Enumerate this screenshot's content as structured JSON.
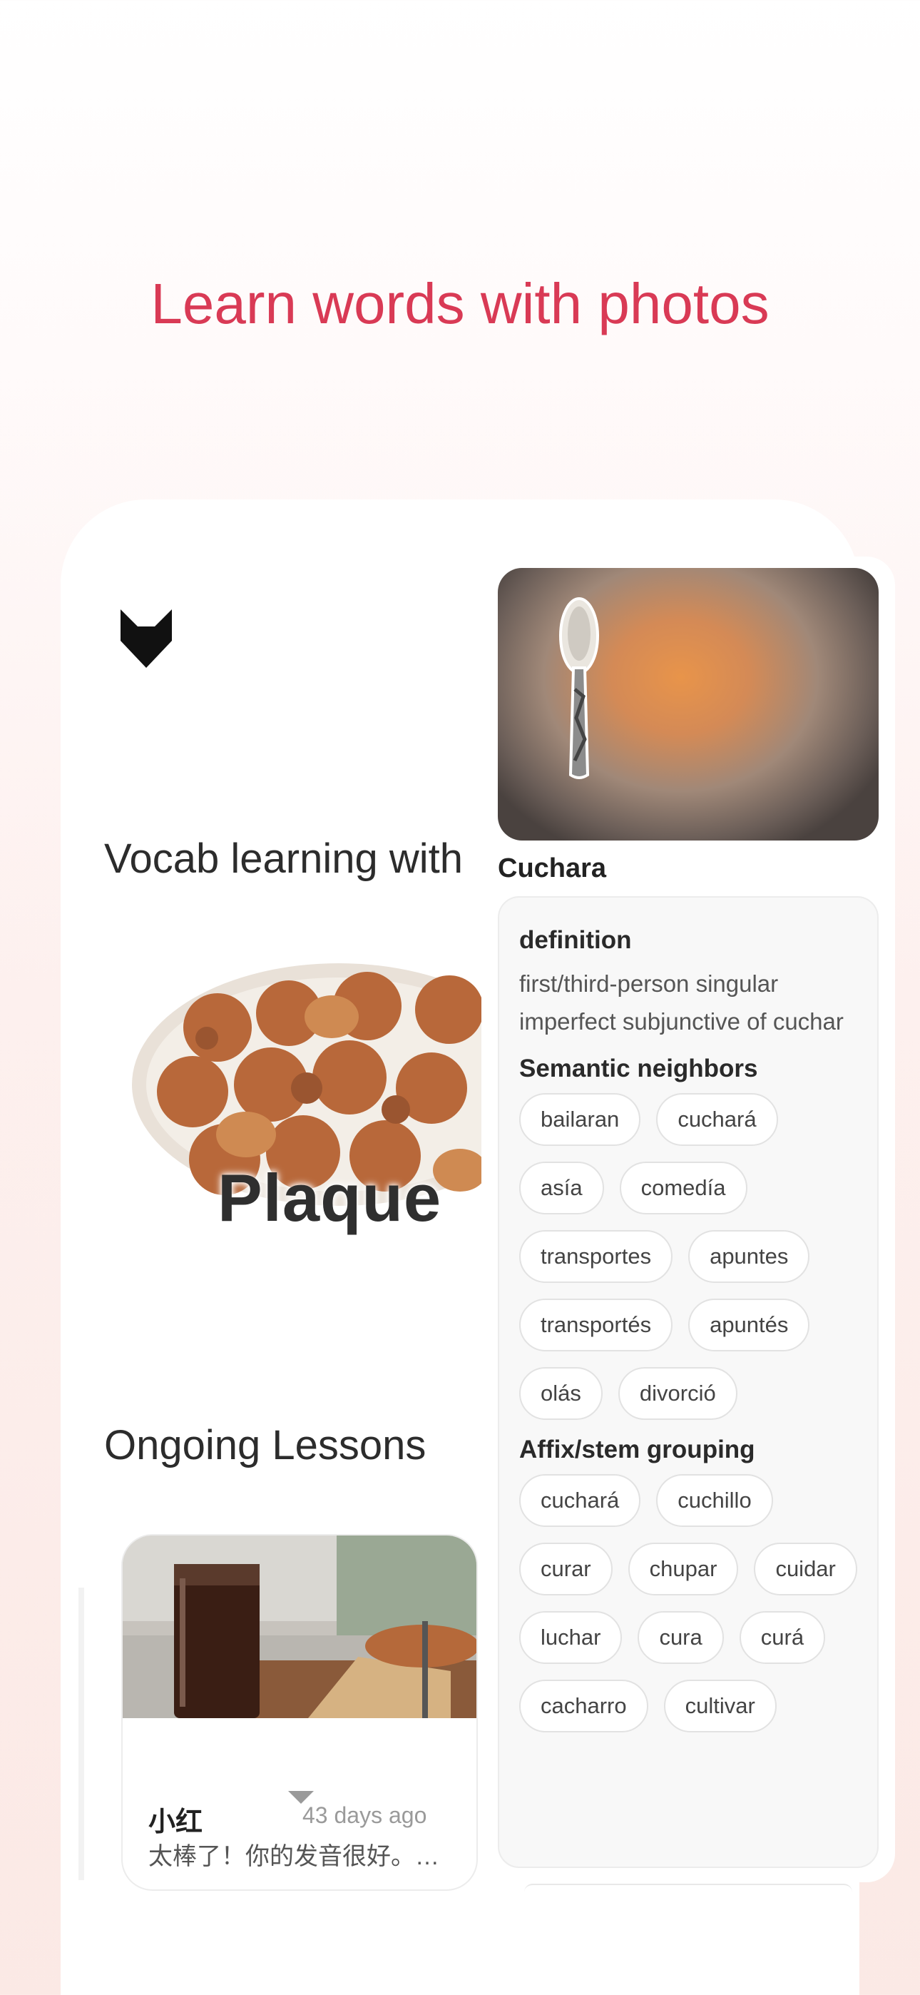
{
  "hero": {
    "title": "Learn words with photos"
  },
  "left": {
    "vocab_heading": "Vocab learning with",
    "plate_word": "Plaque",
    "lessons_heading": "Ongoing Lessons",
    "lesson": {
      "name": "小红",
      "time": "43 days ago",
      "message": "太棒了！你的发音很好。…"
    }
  },
  "dictionary": {
    "word": "Cuchara",
    "definition_label": "definition",
    "definition": "first/third-person singular imperfect subjunctive of cuchar",
    "semantic_label": "Semantic neighbors",
    "semantic_neighbors": [
      "bailaran",
      "cuchará",
      "asía",
      "comedía",
      "transportes",
      "apuntes",
      "transportés",
      "apuntés",
      "olás",
      "divorció"
    ],
    "affix_label": "Affix/stem grouping",
    "affix_group": [
      "cuchará",
      "cuchillo",
      "curar",
      "chupar",
      "cuidar",
      "luchar",
      "cura",
      "curá",
      "cacharro",
      "cultivar"
    ]
  },
  "colors": {
    "accent": "#d93a55",
    "background_tint": "#fbe9e5"
  },
  "icons": {
    "logo": "fox-logo-icon",
    "caret": "caret-down-icon"
  }
}
